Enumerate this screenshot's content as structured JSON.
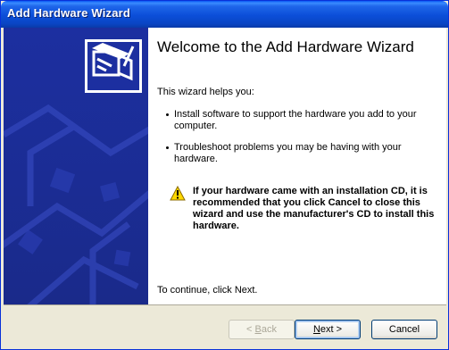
{
  "window": {
    "title": "Add Hardware Wizard"
  },
  "content": {
    "heading": "Welcome to the Add Hardware Wizard",
    "intro": "This wizard helps you:",
    "bullets": [
      "Install software to support the hardware you add to your computer.",
      "Troubleshoot problems you may be having with your hardware."
    ],
    "warning": "If your hardware came with an installation CD, it is recommended that you click Cancel to close this wizard and use the manufacturer's CD to install this hardware.",
    "continue": "To continue, click Next."
  },
  "buttons": {
    "back": {
      "pre": "< ",
      "key": "B",
      "post": "ack",
      "enabled": false
    },
    "next": {
      "key": "N",
      "post": "ext >",
      "enabled": true
    },
    "cancel": {
      "label": "Cancel",
      "enabled": true
    }
  },
  "colors": {
    "title_bar": "#0a4ed8",
    "side_panel": "#1c2fa0",
    "dialog_bg": "#ece9d8",
    "warning_icon": "#ffd800"
  },
  "icons": {
    "hardware": "hardware-wizard-icon",
    "warning": "warning-icon"
  }
}
